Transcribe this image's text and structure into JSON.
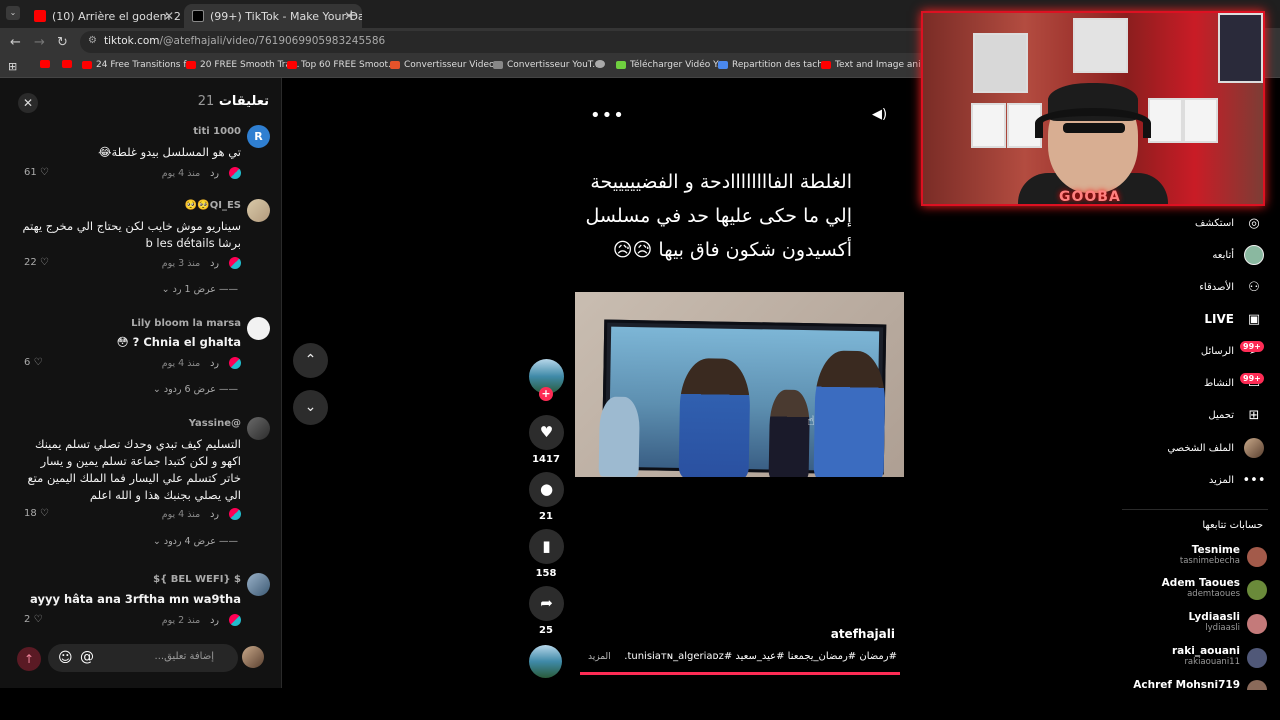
{
  "browser": {
    "tabs": [
      {
        "title": "(10) Arrière el godem 2 Épisode",
        "favicon": "youtube-icon",
        "color": "#ff0000"
      },
      {
        "title": "(99+) TikTok - Make Your Day",
        "favicon": "tiktok-icon",
        "color": "#111111"
      }
    ],
    "url_host": "tiktok.com",
    "url_path": "/@atefhajali/video/7619069905983245586",
    "bookmarks": [
      {
        "label": "",
        "icon": "youtube-icon"
      },
      {
        "label": "",
        "icon": "youtube-icon"
      },
      {
        "label": "24 Free Transitions f...",
        "icon": "youtube-icon"
      },
      {
        "label": "20 FREE Smooth Tra...",
        "icon": "youtube-icon"
      },
      {
        "label": "Top 60 FREE Smoot...",
        "icon": "youtube-icon"
      },
      {
        "label": "Convertisseur Video...",
        "icon": "z-icon"
      },
      {
        "label": "Convertisseur YouT...",
        "icon": "converter-icon"
      },
      {
        "label": "",
        "icon": "globe-icon"
      },
      {
        "label": "Télécharger Vidéo Y...",
        "icon": "download-icon"
      },
      {
        "label": "Repartition des tach...",
        "icon": "docs-icon"
      },
      {
        "label": "Text and Image ani...",
        "icon": "youtube-icon"
      }
    ]
  },
  "comments_panel": {
    "title": "تعليقات",
    "count": "21",
    "input_placeholder": "إضافة تعليق...",
    "items": [
      {
        "user": "titi 1000",
        "text": "تي هو المسلسل بيدو غلطة😂",
        "time": "منذ 4 يوم",
        "reply": "رد",
        "likes": "61",
        "more": ""
      },
      {
        "user": "🥺🥺QI_ES",
        "text": "سيناريو موش خايب لكن يحتاج الي مخرج يهتم برشا b les détails",
        "time": "منذ 3 يوم",
        "reply": "رد",
        "likes": "22",
        "more": "عرض 1 رد"
      },
      {
        "user": "Lily bloom la marsa",
        "text": "Chnia el ghalta ? 😳",
        "time": "منذ 4 يوم",
        "reply": "رد",
        "likes": "6",
        "more": "عرض 6 ردود"
      },
      {
        "user": "Yassine@",
        "text": "التسليم كيف تبدي وحدك تصلي تسلم يمينك اكهو و لكن كتبدا جماعة تسلم يمين و يسار خاتر كتسلم علي اليسار فما الملك اليمين متع الي يصلي بجنبك هذا و الله اعلم",
        "time": "منذ 4 يوم",
        "reply": "رد",
        "likes": "18",
        "more": "عرض 4 ردود"
      },
      {
        "user": "${ BEL WEFI} $",
        "text": "ayyy hâta ana 3rftha mn wa9tha",
        "time": "منذ 2 يوم",
        "reply": "رد",
        "likes": "2",
        "more": ""
      }
    ]
  },
  "video": {
    "caption": "الغلطة الفاااااااادحة و الفضيييييحة إلي ما حكى عليها حد في مسلسل أكسيدون شكون فاق بيها 😥😥",
    "author": "atefhajali",
    "hashtags": "#رمضان #رمضان_يجمعنا #عيد_سعيد #tunisiaᴛɴ_algeriaᴅᴢ...",
    "more_label": "المزيد",
    "progress": 1.0,
    "likes": "1417",
    "comments": "21",
    "saves": "158",
    "shares": "25"
  },
  "webcam": {
    "overlay_text": "GOOBA"
  },
  "sidebar": {
    "nav": [
      {
        "label": "استكشف",
        "icon": "compass-icon"
      },
      {
        "label": "أتابعه",
        "icon": "following-avatar-icon"
      },
      {
        "label": "الأصدقاء",
        "icon": "friends-icon"
      },
      {
        "label": "LIVE",
        "icon": "live-tv-icon"
      },
      {
        "label": "الرسائل",
        "icon": "messages-icon",
        "badge": "99+"
      },
      {
        "label": "النشاط",
        "icon": "activity-icon",
        "badge": "99+"
      },
      {
        "label": "تحميل",
        "icon": "upload-icon"
      },
      {
        "label": "الملف الشخصي",
        "icon": "profile-avatar-icon"
      },
      {
        "label": "المزيد",
        "icon": "more-icon"
      }
    ],
    "following_title": "حسابات تتابعها",
    "accounts": [
      {
        "name": "Tesnime",
        "handle": "tasnimebecha",
        "color": "#a35a4a"
      },
      {
        "name": "Adem Taoues",
        "handle": "ademtaoues",
        "color": "#6a8a3a"
      },
      {
        "name": "Lydiaasli",
        "handle": "lydiaasli",
        "color": "#c47a7a"
      },
      {
        "name": "raki_aouani",
        "handle": "rakiaouani11",
        "color": "#505878"
      },
      {
        "name": "Achref Mohsni719",
        "handle": "",
        "color": "#8a6a5a"
      }
    ]
  }
}
